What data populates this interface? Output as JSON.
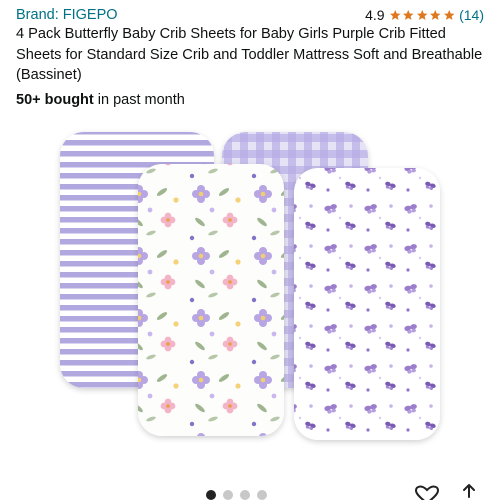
{
  "listing": {
    "brand": "Brand: FIGEPO",
    "rating_value": "4.9",
    "stars": 5,
    "review_count": "(14)",
    "title": "4 Pack Butterfly Baby Crib Sheets for Baby Girls Purple Crib Fitted Sheets for Standard Size Crib and Toddler Mattress Soft and Breathable (Bassinet)",
    "bought_bold": "50+ bought",
    "bought_rest": " in past month"
  },
  "carousel": {
    "image_count": 4,
    "active_index": 0
  },
  "colors": {
    "link": "#007185",
    "star": "#de7921",
    "purple": "#a79bd9",
    "text": "#0f1111"
  },
  "icons": {
    "favorite": "heart-icon",
    "share": "share-icon"
  }
}
